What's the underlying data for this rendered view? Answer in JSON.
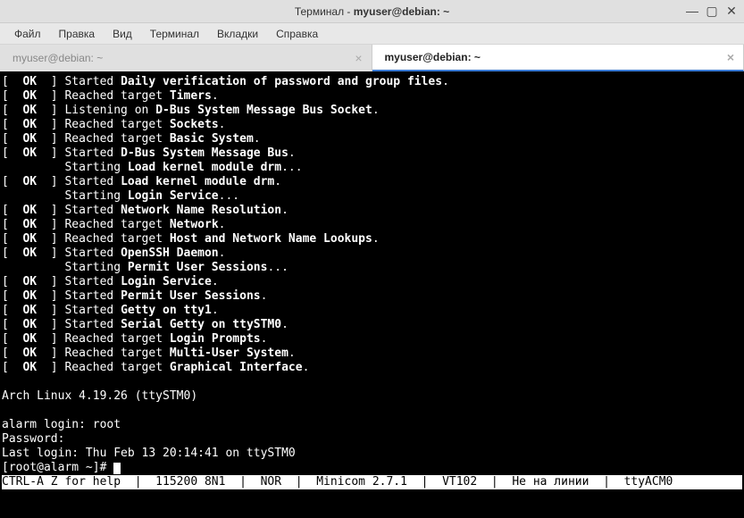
{
  "window": {
    "title_prefix": "Терминал - ",
    "title_bold": "myuser@debian: ~",
    "controls": {
      "min": "—",
      "max": "▢",
      "close": "✕"
    }
  },
  "menubar": {
    "items": [
      "Файл",
      "Правка",
      "Вид",
      "Терминал",
      "Вкладки",
      "Справка"
    ]
  },
  "tabs": [
    {
      "label": "myuser@debian: ~",
      "active": false
    },
    {
      "label": "myuser@debian: ~",
      "active": true
    }
  ],
  "close_glyph": "×",
  "boot_lines": [
    {
      "status": "OK",
      "action": "Started",
      "unit": "Daily verification of password and group files",
      "suffix": "."
    },
    {
      "status": "OK",
      "action": "Reached target",
      "unit": "Timers",
      "suffix": "."
    },
    {
      "status": "OK",
      "action": "Listening on",
      "unit": "D-Bus System Message Bus Socket",
      "suffix": "."
    },
    {
      "status": "OK",
      "action": "Reached target",
      "unit": "Sockets",
      "suffix": "."
    },
    {
      "status": "OK",
      "action": "Reached target",
      "unit": "Basic System",
      "suffix": "."
    },
    {
      "status": "OK",
      "action": "Started",
      "unit": "D-Bus System Message Bus",
      "suffix": "."
    },
    {
      "status": null,
      "action": "Starting",
      "unit": "Load kernel module drm",
      "suffix": "..."
    },
    {
      "status": "OK",
      "action": "Started",
      "unit": "Load kernel module drm",
      "suffix": "."
    },
    {
      "status": null,
      "action": "Starting",
      "unit": "Login Service",
      "suffix": "..."
    },
    {
      "status": "OK",
      "action": "Started",
      "unit": "Network Name Resolution",
      "suffix": "."
    },
    {
      "status": "OK",
      "action": "Reached target",
      "unit": "Network",
      "suffix": "."
    },
    {
      "status": "OK",
      "action": "Reached target",
      "unit": "Host and Network Name Lookups",
      "suffix": "."
    },
    {
      "status": "OK",
      "action": "Started",
      "unit": "OpenSSH Daemon",
      "suffix": "."
    },
    {
      "status": null,
      "action": "Starting",
      "unit": "Permit User Sessions",
      "suffix": "..."
    },
    {
      "status": "OK",
      "action": "Started",
      "unit": "Login Service",
      "suffix": "."
    },
    {
      "status": "OK",
      "action": "Started",
      "unit": "Permit User Sessions",
      "suffix": "."
    },
    {
      "status": "OK",
      "action": "Started",
      "unit": "Getty on tty1",
      "suffix": "."
    },
    {
      "status": "OK",
      "action": "Started",
      "unit": "Serial Getty on ttySTM0",
      "suffix": "."
    },
    {
      "status": "OK",
      "action": "Reached target",
      "unit": "Login Prompts",
      "suffix": "."
    },
    {
      "status": "OK",
      "action": "Reached target",
      "unit": "Multi-User System",
      "suffix": "."
    },
    {
      "status": "OK",
      "action": "Reached target",
      "unit": "Graphical Interface",
      "suffix": "."
    }
  ],
  "tail": {
    "uname": "Arch Linux 4.19.26 (ttySTM0)",
    "login_prompt": "alarm login: root",
    "password_prompt": "Password:",
    "last_login": "Last login: Thu Feb 13 20:14:41 on ttySTM0",
    "prompt": "[root@alarm ~]# ",
    "status_line": "CTRL-A Z for help  |  115200 8N1  |  NOR  |  Minicom 2.7.1  |  VT102  |  Не на линии  |  ttyACM0"
  }
}
